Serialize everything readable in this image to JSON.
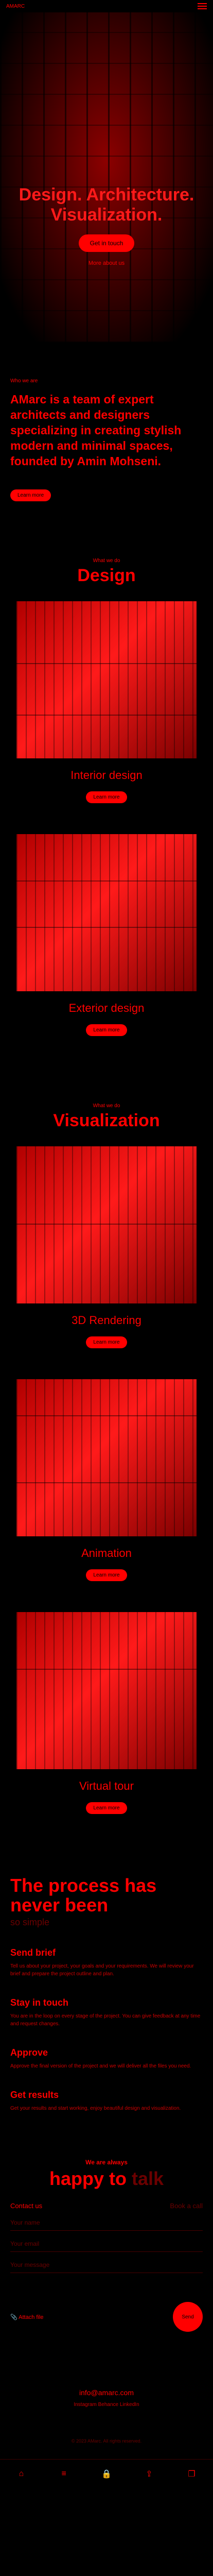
{
  "header": {
    "logo": "AMARC",
    "menu_icon": "hamburger-icon"
  },
  "hero": {
    "title": "Design. Architecture. Visualization.",
    "cta": "Get in touch",
    "sub": "More about us"
  },
  "about": {
    "label": "Who we are",
    "text": "AMarc is a team of expert architects and designers specializing in creating stylish modern and minimal spaces, founded by Amin Mohseni.",
    "more": "Learn more"
  },
  "design": {
    "eyebrow": "What we do",
    "title": "Design",
    "cards": [
      {
        "title": "Interior design",
        "button": "Learn more"
      },
      {
        "title": "Exterior design",
        "button": "Learn more"
      }
    ]
  },
  "visualization": {
    "eyebrow": "What we do",
    "title": "Visualization",
    "cards": [
      {
        "title": "3D Rendering",
        "button": "Learn more"
      },
      {
        "title": "Animation",
        "button": "Learn more"
      },
      {
        "title": "Virtual tour",
        "button": "Learn more"
      }
    ]
  },
  "process": {
    "title": "The process has never been",
    "subtitle": "so simple",
    "steps": [
      {
        "title": "Send brief",
        "text": "Tell us about your project, your goals and your requirements. We will review your brief and prepare the project outline and plan."
      },
      {
        "title": "Stay in touch",
        "text": "You are in the loop on every stage of the project. You can give feedback at any time and request changes."
      },
      {
        "title": "Approve",
        "text": "Approve the final version of the project and we will deliver all the files you need."
      },
      {
        "title": "Get results",
        "text": "Get your results and start working, enjoy beautiful design and visualization."
      }
    ]
  },
  "contact": {
    "eyebrow": "We are always",
    "big_1": "happy to",
    "big_2": "talk",
    "label": "Contact us",
    "alt": "Book a call",
    "fields": [
      {
        "placeholder": "Your name"
      },
      {
        "placeholder": "Your email"
      },
      {
        "placeholder": "Your message"
      }
    ],
    "attach": "Attach file",
    "send": "Send"
  },
  "footer": {
    "email": "info@amarc.com",
    "socials": "Instagram   Behance   LinkedIn",
    "copy": "© 2023 AMarc. All rights reserved."
  },
  "bottomnav": [
    "home-icon",
    "menu-icon",
    "lock-icon",
    "share-icon",
    "tabs-icon"
  ]
}
